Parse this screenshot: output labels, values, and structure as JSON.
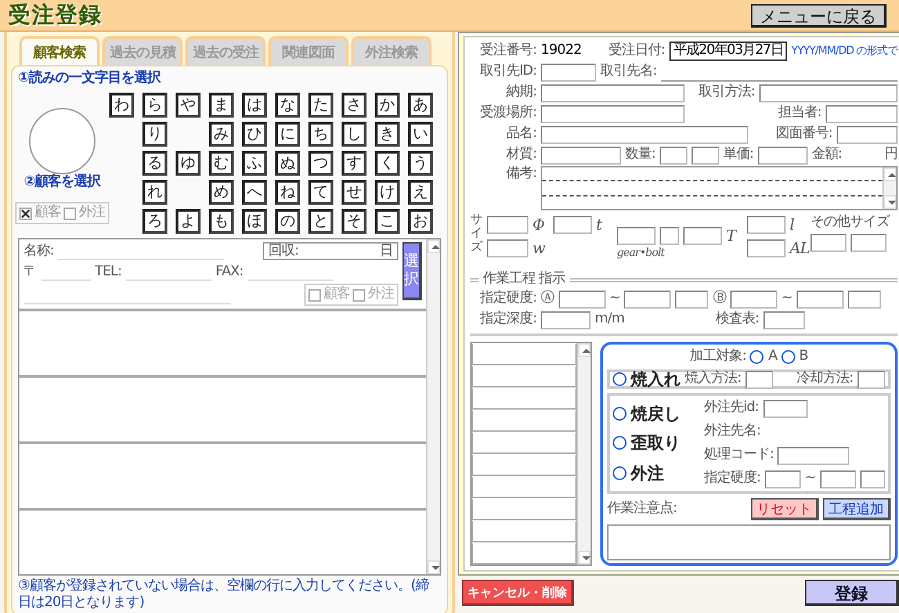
{
  "header": {
    "title": "受注登録",
    "menu_button": "メニューに戻る"
  },
  "customer_panel": {
    "tabs": [
      {
        "label": "顧客検索",
        "selected": true
      },
      {
        "label": "過去の見積",
        "selected": false
      },
      {
        "label": "過去の受注",
        "selected": false
      },
      {
        "label": "関連図面",
        "selected": false
      },
      {
        "label": "外注検索",
        "selected": false
      }
    ],
    "step1": "①読みの一文字目を選択",
    "kana_rows": [
      [
        {
          "kind": "key",
          "label": "わ"
        },
        {
          "kind": "key",
          "label": "ら"
        },
        {
          "kind": "key",
          "label": "や"
        },
        {
          "kind": "key",
          "label": "ま"
        },
        {
          "kind": "key",
          "label": "は"
        },
        {
          "kind": "key",
          "label": "な"
        },
        {
          "kind": "key",
          "label": "た"
        },
        {
          "kind": "key",
          "label": "さ"
        },
        {
          "kind": "key",
          "label": "か"
        },
        {
          "kind": "key",
          "label": "あ"
        }
      ],
      [
        {
          "kind": "gap"
        },
        {
          "kind": "key",
          "label": "り"
        },
        {
          "kind": "gap"
        },
        {
          "kind": "key",
          "label": "み"
        },
        {
          "kind": "key",
          "label": "ひ"
        },
        {
          "kind": "key",
          "label": "に"
        },
        {
          "kind": "key",
          "label": "ち"
        },
        {
          "kind": "key",
          "label": "し"
        },
        {
          "kind": "key",
          "label": "き"
        },
        {
          "kind": "key",
          "label": "い"
        }
      ],
      [
        {
          "kind": "gap"
        },
        {
          "kind": "key",
          "label": "る"
        },
        {
          "kind": "key",
          "label": "ゆ"
        },
        {
          "kind": "key",
          "label": "む"
        },
        {
          "kind": "key",
          "label": "ふ"
        },
        {
          "kind": "key",
          "label": "ぬ"
        },
        {
          "kind": "key",
          "label": "つ"
        },
        {
          "kind": "key",
          "label": "す"
        },
        {
          "kind": "key",
          "label": "く"
        },
        {
          "kind": "key",
          "label": "う"
        }
      ],
      [
        {
          "kind": "gap"
        },
        {
          "kind": "key",
          "label": "れ"
        },
        {
          "kind": "gap"
        },
        {
          "kind": "key",
          "label": "め"
        },
        {
          "kind": "key",
          "label": "へ"
        },
        {
          "kind": "key",
          "label": "ね"
        },
        {
          "kind": "key",
          "label": "て"
        },
        {
          "kind": "key",
          "label": "せ"
        },
        {
          "kind": "key",
          "label": "け"
        },
        {
          "kind": "key",
          "label": "え"
        }
      ],
      [
        {
          "kind": "gap"
        },
        {
          "kind": "key",
          "label": "ろ"
        },
        {
          "kind": "key",
          "label": "よ"
        },
        {
          "kind": "key",
          "label": "も"
        },
        {
          "kind": "key",
          "label": "ほ"
        },
        {
          "kind": "key",
          "label": "の"
        },
        {
          "kind": "key",
          "label": "と"
        },
        {
          "kind": "key",
          "label": "そ"
        },
        {
          "kind": "key",
          "label": "こ"
        },
        {
          "kind": "key",
          "label": "お"
        }
      ]
    ],
    "step2": "②顧客を選択",
    "filters": [
      {
        "label": "顧客",
        "checked": true
      },
      {
        "label": "外注",
        "checked": false
      }
    ],
    "customers": [
      {
        "kind": "form",
        "name_label": "名称:",
        "collect_label": "回収:",
        "collect_unit": "日",
        "zip_label": "〒",
        "tel_label": "TEL:",
        "fax_label": "FAX:",
        "flags": [
          {
            "label": "顧客",
            "checked": false
          },
          {
            "label": "外注",
            "checked": false
          }
        ],
        "select_button": "選択"
      },
      {
        "kind": "empty"
      },
      {
        "kind": "empty"
      },
      {
        "kind": "empty"
      },
      {
        "kind": "empty"
      }
    ],
    "note": "③顧客が登録されていない場合は、空欄の行に入力してください。(締日は20日となります)"
  },
  "order": {
    "number_label": "受注番号:",
    "number": "19022",
    "date_label": "受注日付:",
    "date": "平成20年03月27日",
    "date_hint": "YYYY/MM/DD の形式で",
    "client_id_label": "取引先ID:",
    "client_name_label": "取引先名:",
    "due_label": "納期:",
    "method_label": "取引方法:",
    "place_label": "受渡場所:",
    "staff_label": "担当者:",
    "product_label": "品名:",
    "drawing_label": "図面番号:",
    "material_label": "材質:",
    "qty_label": "数量:",
    "price_label": "単価:",
    "amount_label": "金額:",
    "amount_unit": "円",
    "remarks_label": "備考:",
    "size": {
      "label": "サイズ",
      "phi": "Φ",
      "t": "t",
      "w": "w",
      "gear": "gear•bolt",
      "T": "T",
      "l": "l",
      "AL": "AL",
      "other": "その他サイズ"
    },
    "process_title": "作業工程 指示",
    "hardness_label": "指定硬度:",
    "hardness_a": {
      "mark": "Ⓐ",
      "sep": "~"
    },
    "hardness_b": {
      "mark": "Ⓑ",
      "sep": "~"
    },
    "depth_label": "指定深度:",
    "depth_unit": "m/m",
    "inspection_label": "検査表:",
    "target_label": "加工対象:",
    "targets": [
      {
        "label": "A",
        "selected": false
      },
      {
        "label": "B",
        "selected": false
      }
    ],
    "processes": [
      {
        "kind": "quench",
        "label": "焼入れ",
        "selected": false
      },
      {
        "kind": "temper",
        "label": "焼戻し",
        "selected": false
      },
      {
        "kind": "straighten",
        "label": "歪取り",
        "selected": false
      },
      {
        "kind": "outsource",
        "label": "外注",
        "selected": false
      }
    ],
    "quench_method_label": "焼入方法:",
    "cooling_label": "冷却方法:",
    "vendor_id_label": "外注先id:",
    "vendor_name_label": "外注先名:",
    "code_label": "処理コード:",
    "vendor_hardness_label": "指定硬度:",
    "vendor_sep": "~",
    "notes_label": "作業注意点:",
    "reset_button": "リセット",
    "add_button": "工程追加"
  },
  "footer": {
    "cancel_button": "キャンセル・削除",
    "register_button": "登録"
  }
}
